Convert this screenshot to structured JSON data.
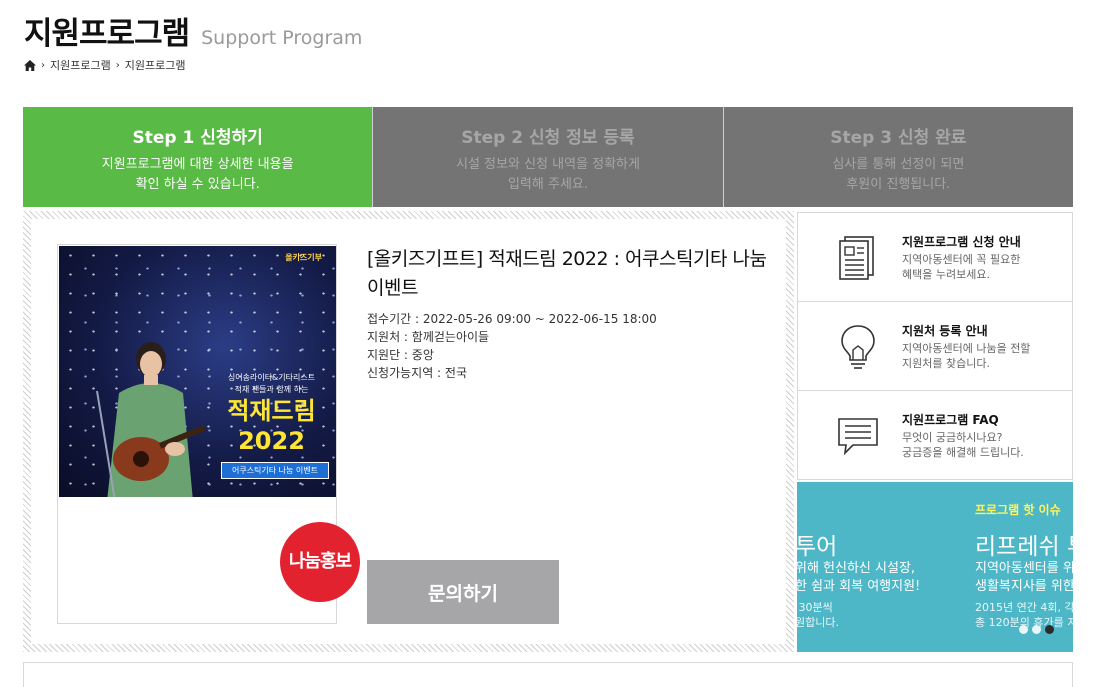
{
  "header": {
    "title": "지원프로그램",
    "subtitle": "Support Program"
  },
  "breadcrumb": {
    "home_icon": "home-icon",
    "items": [
      "지원프로그램",
      "지원프로그램"
    ]
  },
  "steps": [
    {
      "title": "Step 1 신청하기",
      "desc": "지원프로그램에 대한 상세한 내용을\n확인 하실 수 있습니다."
    },
    {
      "title": "Step 2 신청 정보 등록",
      "desc": "시설 정보와 신청 내역을 정확하게\n입력해 주세요."
    },
    {
      "title": "Step 3 신청 완료",
      "desc": "심사를 통해 선정이 되면\n후원이 진행됩니다."
    }
  ],
  "program": {
    "title": "[올키즈기프트] 적재드림 2022 : 어쿠스틱기타 나눔 이벤트",
    "period": "접수기간 : 2022-05-26 09:00 ~ 2022-06-15 18:00",
    "sponsor": "지원처 : 함께걷는아이들",
    "group": "지원단 : 중앙",
    "region": "신청가능지역 : 전국",
    "badge": "나눔홍보",
    "inquiry_label": "문의하기",
    "poster": {
      "logo": "올키즈기부",
      "caption": "싱어송라이터&기타리스트\n적재 팬들과 함께 하는",
      "headline_1": "적재드림",
      "headline_2": "2022",
      "pill": "어쿠스틱기타 나눔 이벤트"
    }
  },
  "guide": [
    {
      "icon": "document-icon",
      "title": "지원프로그램 신청 안내",
      "desc": "지역아동센터에 꼭 필요한\n혜택을 누려보세요."
    },
    {
      "icon": "lightbulb-icon",
      "title": "지원처 등록 안내",
      "desc": "지역아동센터에 나눔을 전할\n지원처를 찾습니다."
    },
    {
      "icon": "chat-icon",
      "title": "지원프로그램 FAQ",
      "desc": "무엇이 궁금하시나요?\n궁금증을 해결해 드립니다."
    }
  ],
  "banner": {
    "tag": "프로그램 핫 이슈",
    "left_title": "투어",
    "left_desc": "위해 헌신하신 시설장,\n한 쉼과 회복 여행지원!",
    "left_small": " 30분씩\n원합니다.",
    "right_title": "리프레쉬 투",
    "right_desc": "지역아동센터를 위\n생활복지사를 위한",
    "right_small": "2015년 연간 4회, 각\n총 120분의 휴가를 지",
    "active_dot": 2,
    "dot_count": 3
  },
  "colors": {
    "step_active": "#5aba46",
    "step_inactive": "#747474",
    "badge": "#e3222f",
    "inquiry": "#a6a6a8",
    "banner": "#4db7c7"
  }
}
